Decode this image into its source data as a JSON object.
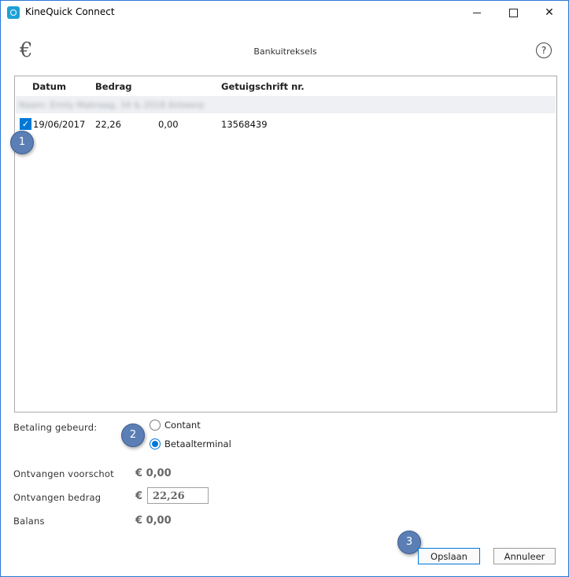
{
  "window": {
    "title": "KineQuick Connect"
  },
  "header": {
    "title": "Bankuitreksels",
    "help_glyph": "?",
    "currency_glyph": "€"
  },
  "table": {
    "columns": [
      "Datum",
      "Bedrag",
      "Getuigschrift nr."
    ],
    "group_label": "Naam: Emily Mabraag, 34 & 2018 Antwerp",
    "rows": [
      {
        "checked": true,
        "date": "19/06/2017",
        "amount": "22,26",
        "paid": "0,00",
        "cert": "13568439"
      }
    ]
  },
  "markers": [
    "1",
    "2",
    "3"
  ],
  "payment": {
    "label": "Betaling gebeurd:",
    "options": [
      {
        "label": "Contant",
        "selected": false
      },
      {
        "label": "Betaalterminal",
        "selected": true
      }
    ]
  },
  "amounts": {
    "advance_label": "Ontvangen voorschot",
    "advance_value": "€ 0,00",
    "received_label": "Ontvangen bedrag",
    "currency": "€",
    "received_value": "22,26",
    "balance_label": "Balans",
    "balance_value": "€ 0,00"
  },
  "buttons": {
    "save": "Opslaan",
    "cancel": "Annuleer"
  },
  "colors": {
    "accent": "#0078d7",
    "marker": "#5b7fb4",
    "window_border": "#2b79d8"
  }
}
